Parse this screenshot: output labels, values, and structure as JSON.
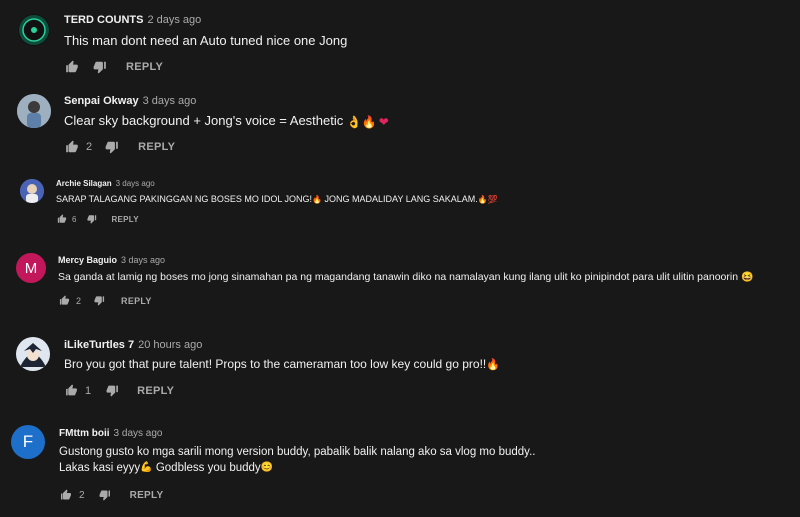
{
  "comments": [
    {
      "author": "TERD COUNTS",
      "time": "2 days ago",
      "text": "This man dont need an Auto tuned nice one Jong",
      "likes": "",
      "reply": "REPLY",
      "avatar_icon": "green-record-logo",
      "avatar_color": "#0e4d3c"
    },
    {
      "author": "Senpai Okway",
      "time": "3 days ago",
      "text": "Clear sky background + Jong's voice = Aesthetic",
      "emojis": [
        "ok-hand",
        "fire",
        "red-heart"
      ],
      "likes": "2",
      "reply": "REPLY",
      "avatar_icon": "person-photo",
      "avatar_color": "#7d8a96"
    },
    {
      "author": "Archie Silagan",
      "time": "3 days ago",
      "text": "SARAP TALAGANG PAKINGGAN NG BOSES MO IDOL JONG!",
      "text2": " JONG MADALIDAY LANG SAKALAM.",
      "emojis": [
        "fire",
        "fire",
        "hundred"
      ],
      "likes": "6",
      "reply": "REPLY",
      "avatar_icon": "person-photo",
      "avatar_color": "#4a63b5"
    },
    {
      "author": "Mercy Baguio",
      "time": "3 days ago",
      "text": "Sa ganda at lamig ng boses mo jong sinamahan pa ng magandang tanawin diko na namalayan kung ilang ulit ko pinipindot para ulit ulitin panoorin",
      "emojis": [
        "grinning-face"
      ],
      "likes": "2",
      "reply": "REPLY",
      "avatar_letter": "M",
      "avatar_color": "#c2185b"
    },
    {
      "author": "iLikeTurtles 7",
      "time": "20 hours ago",
      "text": "Bro you got that pure talent! Props to the cameraman too low key could go pro!!",
      "emojis": [
        "fire"
      ],
      "likes": "1",
      "reply": "REPLY",
      "avatar_icon": "anime-character",
      "avatar_color": "#2b3a55"
    },
    {
      "author": "FMttm boii",
      "time": "3 days ago",
      "text": "Gustong gusto ko mga sarili mong version buddy,  pabalik balik nalang ako sa vlog mo buddy..",
      "text2": "Lakas kasi eyyy",
      "text3": "  Godbless you buddy",
      "emojis": [
        "flexed-biceps",
        "smiling-face"
      ],
      "likes": "2",
      "reply": "REPLY",
      "avatar_letter": "F",
      "avatar_color": "#1e6fc9"
    }
  ]
}
